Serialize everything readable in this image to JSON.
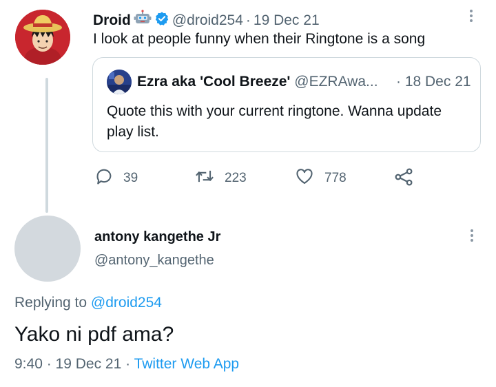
{
  "tweet": {
    "author_name": "Droid",
    "author_handle": "@droid254",
    "separator": "·",
    "date": "19 Dec 21",
    "text": "I look at people funny when their Ringtone is a song",
    "quote": {
      "author_name": "Ezra aka 'Cool Breeze'",
      "author_handle": "@EZRAwa...",
      "date": "· 18 Dec 21",
      "text": "Quote this with your current ringtone. Wanna update play list."
    },
    "actions": {
      "replies": "39",
      "retweets": "223",
      "likes": "778"
    }
  },
  "reply": {
    "author_name": "antony kangethe Jr",
    "author_handle": "@antony_kangethe",
    "replying_prefix": "Replying to ",
    "replying_to": "@droid254",
    "text": "Yako ni pdf ama?",
    "time": "9:40",
    "sep1": " · ",
    "date": "19 Dec 21",
    "sep2": " · ",
    "source": "Twitter Web App"
  },
  "colors": {
    "link": "#1d9bf0",
    "verified": "#1d9bf0",
    "muted": "#536471"
  },
  "icons": [
    "robot-emoji-icon",
    "verified-badge-icon",
    "more-icon",
    "reply-icon",
    "retweet-icon",
    "like-icon",
    "share-icon"
  ]
}
